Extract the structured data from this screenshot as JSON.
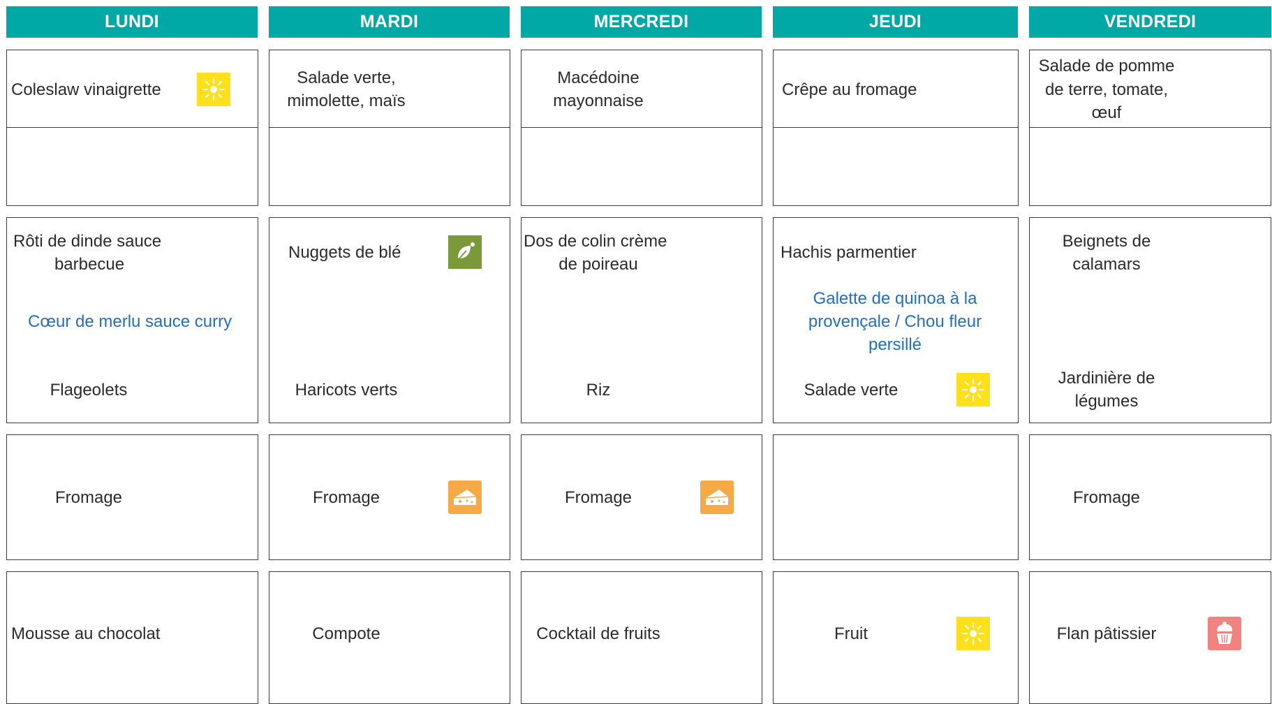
{
  "days": {
    "mon": "LUNDI",
    "tue": "MARDI",
    "wed": "MERCREDI",
    "thu": "JEUDI",
    "fri": "VENDREDI"
  },
  "starters": {
    "mon": "Coleslaw vinaigrette",
    "tue": [
      "Salade verte,",
      "mimolette, maïs"
    ],
    "wed": [
      "Macédoine",
      "mayonnaise"
    ],
    "thu": "Crêpe au fromage",
    "fri": [
      "Salade de pomme",
      "de terre, tomate,",
      "œuf"
    ]
  },
  "mains": {
    "mon": {
      "dish": [
        "Rôti de dinde sauce",
        "barbecue"
      ],
      "alt": "Cœur de merlu sauce curry",
      "side": "Flageolets"
    },
    "tue": {
      "dish": "Nuggets de blé",
      "side": "Haricots verts"
    },
    "wed": {
      "dish": [
        "Dos de colin crème",
        "de poireau"
      ],
      "side": "Riz"
    },
    "thu": {
      "dish": "Hachis parmentier",
      "alt": [
        "Galette de quinoa à la",
        "provençale / Chou fleur",
        "persillé"
      ],
      "side": "Salade verte"
    },
    "fri": {
      "dish": [
        "Beignets de",
        "calamars"
      ],
      "side": [
        "Jardinière de",
        "légumes"
      ]
    }
  },
  "cheese": {
    "mon": "Fromage",
    "tue": "Fromage",
    "wed": "Fromage",
    "thu": "",
    "fri": "Fromage"
  },
  "desserts": {
    "mon": "Mousse au chocolat",
    "tue": "Compote",
    "wed": "Cocktail de fruits",
    "thu": "Fruit",
    "fri": "Flan pâtissier"
  },
  "icons": {
    "mon_starter": "sun-icon",
    "tue_main": "leaf-icon",
    "thu_side": "sun-icon",
    "tue_cheese": "cheese-icon",
    "wed_cheese": "cheese-icon",
    "thu_dessert": "sun-icon",
    "fri_dessert": "cupcake-icon"
  },
  "colors": {
    "header": "#00a9a5",
    "alternative_text": "#1f6fc4",
    "sun": "#ffe11b",
    "leaf": "#7a9a3a",
    "cheese": "#f5a947",
    "cupcake": "#f2827f"
  }
}
